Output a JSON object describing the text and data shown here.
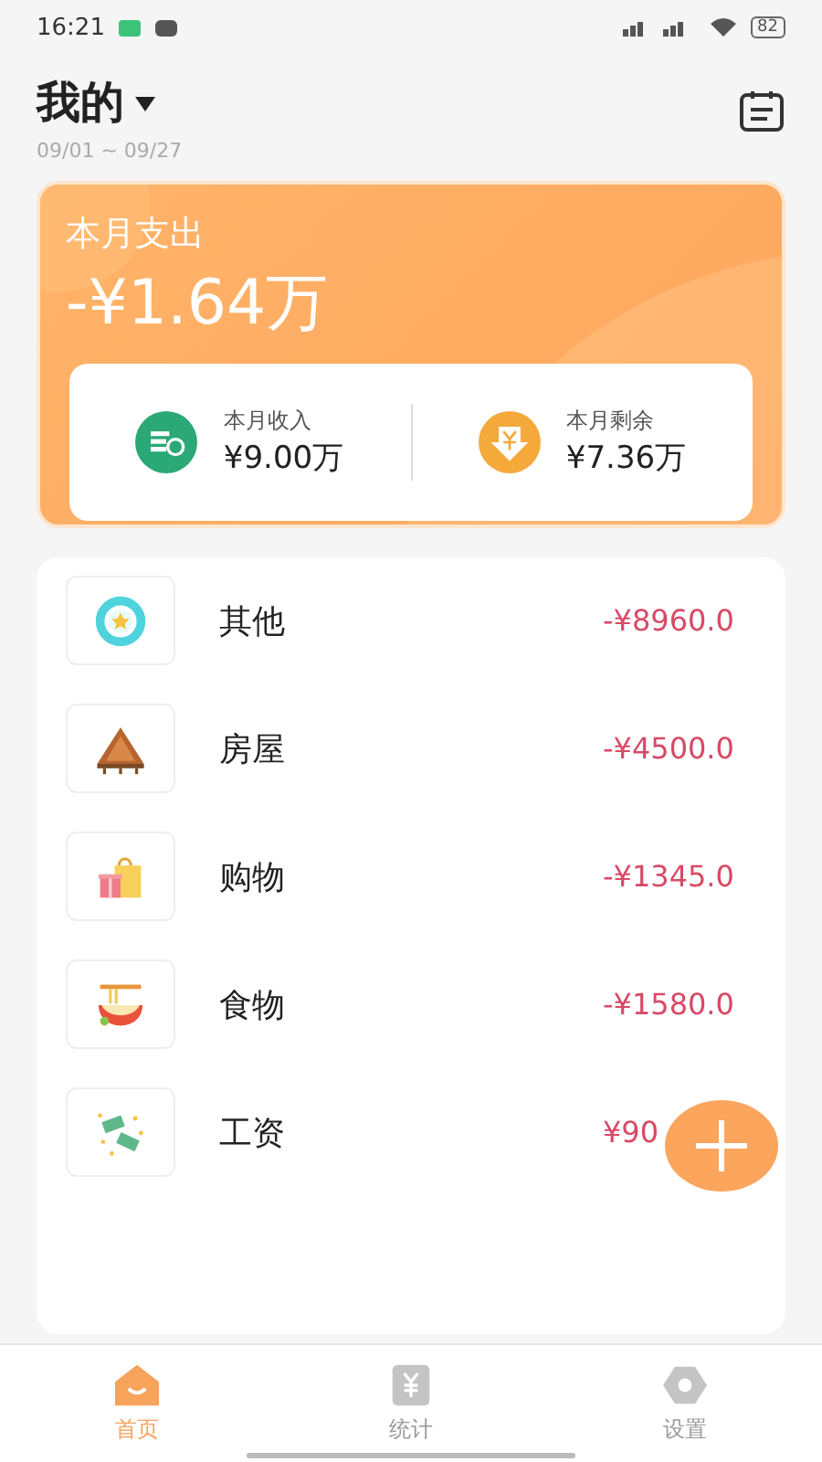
{
  "status_bar": {
    "time": "16:21",
    "battery": "82"
  },
  "header": {
    "title": "我的",
    "date_range": "09/01 ~ 09/27"
  },
  "summary": {
    "label": "本月支出",
    "amount": "-¥1.64万",
    "stats": [
      {
        "kind": "income",
        "label": "本月收入",
        "value": "¥9.00万"
      },
      {
        "kind": "balance",
        "label": "本月剩余",
        "value": "¥7.36万"
      }
    ]
  },
  "categories": [
    {
      "kind": "other",
      "name": "其他",
      "amount": "-¥8960.0"
    },
    {
      "kind": "house",
      "name": "房屋",
      "amount": "-¥4500.0"
    },
    {
      "kind": "shopping",
      "name": "购物",
      "amount": "-¥1345.0"
    },
    {
      "kind": "food",
      "name": "食物",
      "amount": "-¥1580.0"
    },
    {
      "kind": "salary",
      "name": "工资",
      "amount": "¥90"
    }
  ],
  "tabs": [
    {
      "kind": "home",
      "label": "首页",
      "selected": true
    },
    {
      "kind": "stats",
      "label": "统计",
      "selected": false
    },
    {
      "kind": "settings",
      "label": "设置",
      "selected": false
    }
  ]
}
